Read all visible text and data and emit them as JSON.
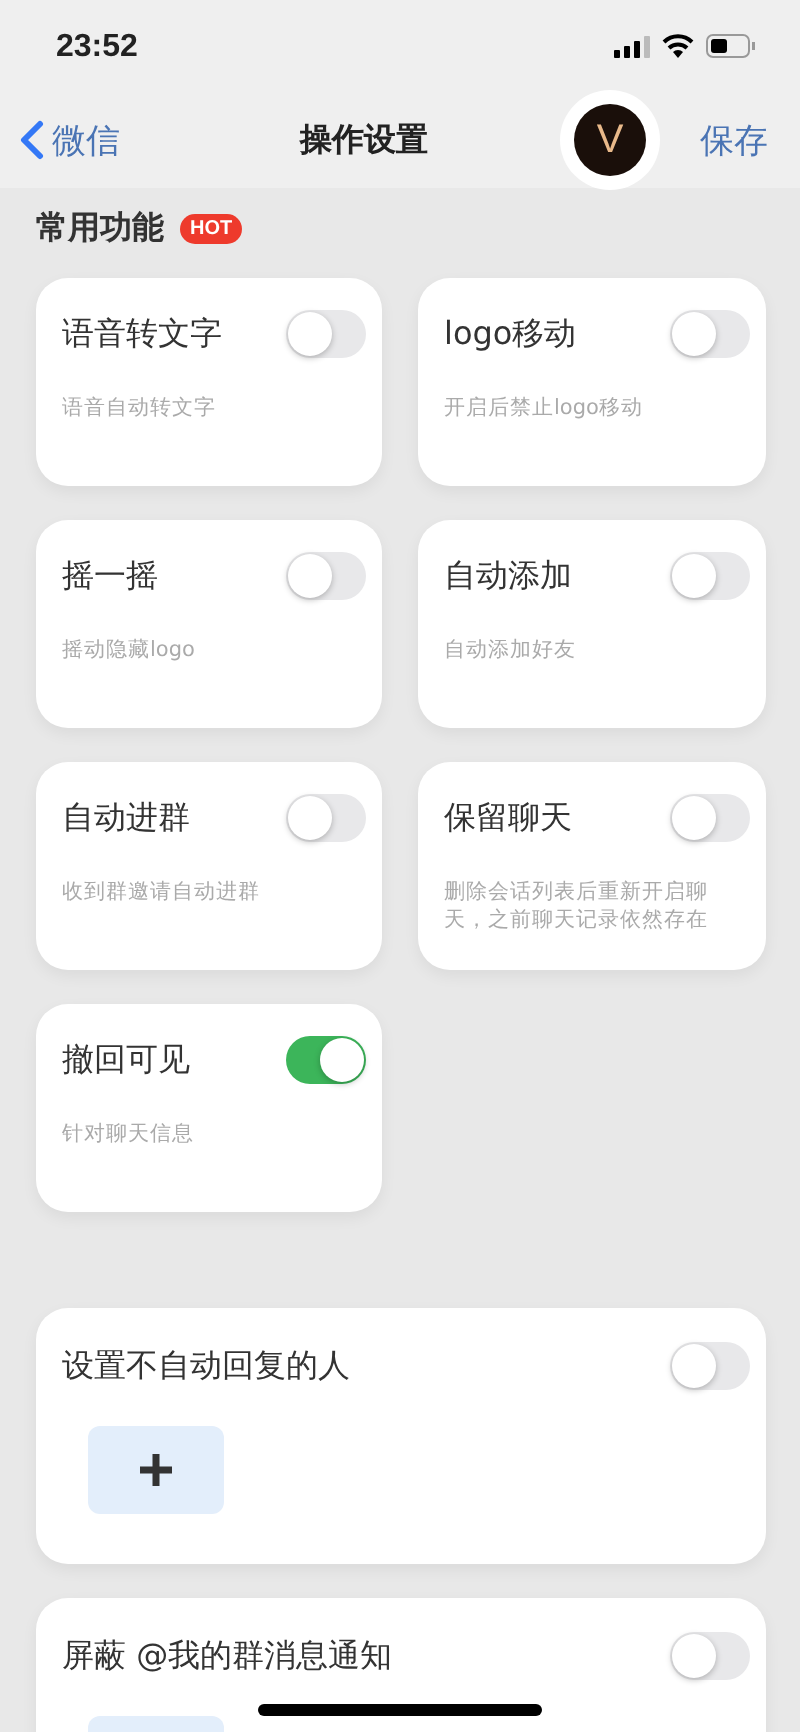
{
  "status_bar": {
    "time": "23:52"
  },
  "nav": {
    "back": "微信",
    "title": "操作设置",
    "avatar_letter": "V",
    "save": "保存"
  },
  "section": {
    "title": "常用功能",
    "badge": "HOT"
  },
  "features": [
    {
      "title": "语音转文字",
      "desc": "语音自动转文字",
      "on": false
    },
    {
      "title": "logo移动",
      "desc": "开启后禁止logo移动",
      "on": false
    },
    {
      "title": "摇一摇",
      "desc": "摇动隐藏logo",
      "on": false
    },
    {
      "title": "自动添加",
      "desc": "自动添加好友",
      "on": false
    },
    {
      "title": "自动进群",
      "desc": "收到群邀请自动进群",
      "on": false
    },
    {
      "title": "保留聊天",
      "desc": "删除会话列表后重新开启聊天，之前聊天记录依然存在",
      "on": false
    },
    {
      "title": "撤回可见",
      "desc": "针对聊天信息",
      "on": true
    }
  ],
  "lists": [
    {
      "title": "设置不自动回复的人",
      "on": false
    },
    {
      "title": "屏蔽 @我的群消息通知",
      "on": false
    }
  ]
}
